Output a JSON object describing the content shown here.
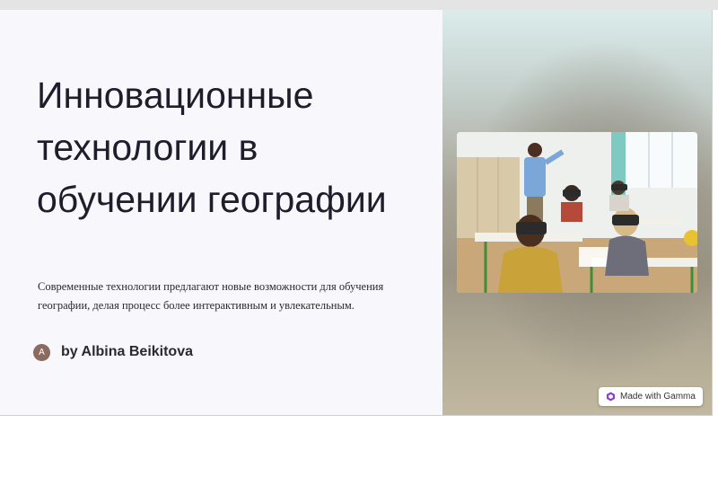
{
  "slide": {
    "title": "Инновационные технологии в обучении географии",
    "subtitle": "Современные технологии предлагают новые возможности для обучения географии, делая процесс более интерактивным и увлекательным.",
    "author": {
      "avatar_initial": "A",
      "byline": "by Albina Beikitova",
      "avatar_color": "#8b6a5f"
    },
    "image": {
      "icon": "classroom-vr-photo"
    }
  },
  "badge": {
    "label": "Made with Gamma",
    "icon": "gamma-logo-icon",
    "accent": "#8b3fd1"
  },
  "colors": {
    "title": "#1e1d2b",
    "slide_bg": "#f8f7fb"
  }
}
